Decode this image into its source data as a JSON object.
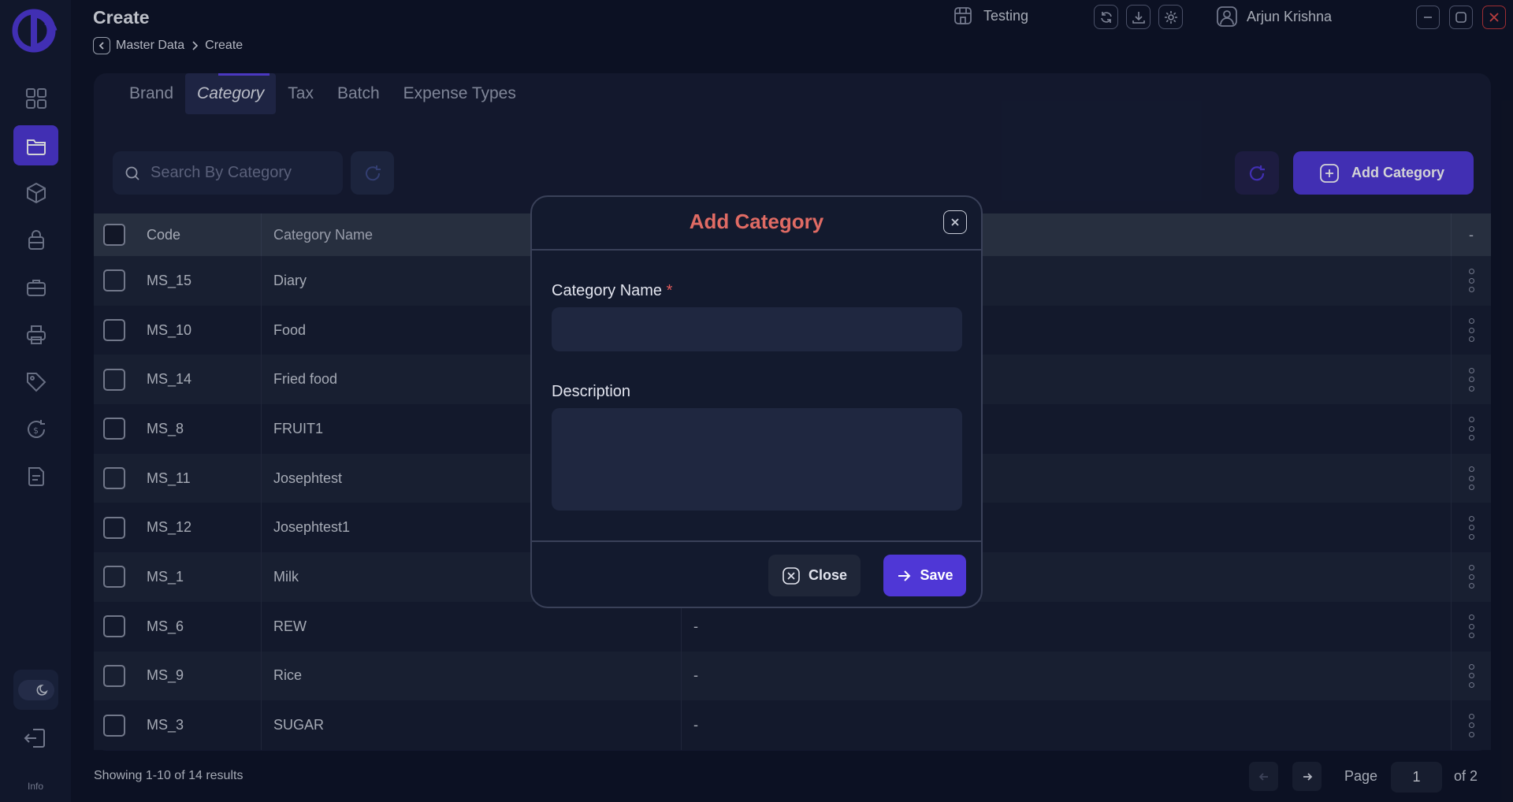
{
  "header": {
    "title": "Create",
    "breadcrumb": [
      "Master Data",
      "Create"
    ],
    "workspace": "Testing",
    "user": "Arjun Krishna"
  },
  "sidebar": {
    "items": [
      {
        "icon": "dashboard-icon",
        "active": false
      },
      {
        "icon": "folder-icon",
        "active": true
      },
      {
        "icon": "box-icon",
        "active": false
      },
      {
        "icon": "bag-icon",
        "active": false
      },
      {
        "icon": "briefcase-icon",
        "active": false
      },
      {
        "icon": "printer-icon",
        "active": false
      },
      {
        "icon": "tag-icon",
        "active": false
      },
      {
        "icon": "dollar-refresh-icon",
        "active": false
      },
      {
        "icon": "document-icon",
        "active": false
      }
    ],
    "info_label": "Info"
  },
  "tabs": [
    {
      "label": "Brand",
      "active": false
    },
    {
      "label": "Category",
      "active": true
    },
    {
      "label": "Tax",
      "active": false
    },
    {
      "label": "Batch",
      "active": false
    },
    {
      "label": "Expense Types",
      "active": false
    }
  ],
  "search": {
    "placeholder": "Search By Category"
  },
  "add_button": {
    "label": "Add Category"
  },
  "table": {
    "columns": [
      "Code",
      "Category Name",
      "",
      "-"
    ],
    "rows": [
      {
        "code": "MS_15",
        "name": "Diary",
        "description": ""
      },
      {
        "code": "MS_10",
        "name": "Food",
        "description": ""
      },
      {
        "code": "MS_14",
        "name": "Fried food",
        "description": ""
      },
      {
        "code": "MS_8",
        "name": "FRUIT1",
        "description": ""
      },
      {
        "code": "MS_11",
        "name": "Josephtest",
        "description": ""
      },
      {
        "code": "MS_12",
        "name": "Josephtest1",
        "description": ""
      },
      {
        "code": "MS_1",
        "name": "Milk",
        "description": ""
      },
      {
        "code": "MS_6",
        "name": "REW",
        "description": "-"
      },
      {
        "code": "MS_9",
        "name": "Rice",
        "description": "-"
      },
      {
        "code": "MS_3",
        "name": "SUGAR",
        "description": "-"
      }
    ]
  },
  "footer": {
    "showing": "Showing 1-10 of 14 results",
    "page_label": "Page",
    "page_value": "1",
    "page_of": "of 2"
  },
  "modal": {
    "title": "Add Category",
    "category_name_label": "Category Name",
    "required_mark": "*",
    "category_name_value": "",
    "description_label": "Description",
    "description_value": "",
    "close_label": "Close",
    "save_label": "Save"
  },
  "colors": {
    "accent": "#4f37d6",
    "modal_title": "#e06b64",
    "background": "#0e1326"
  }
}
